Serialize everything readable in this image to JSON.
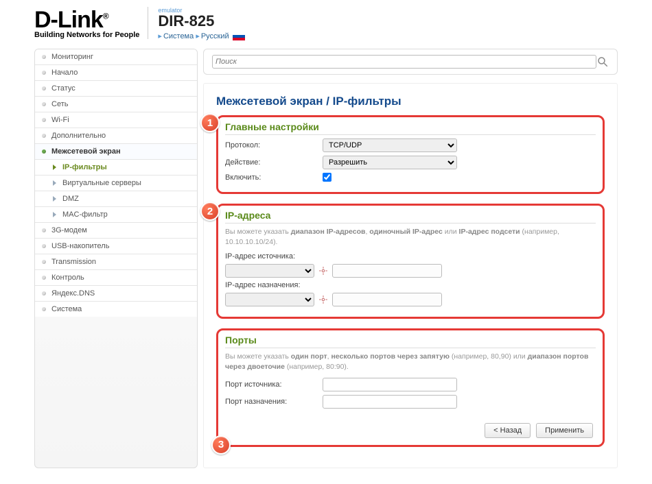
{
  "header": {
    "logo_text": "D-Link",
    "logo_tagline": "Building Networks for People",
    "emulator_label": "emulator",
    "product_name": "DIR-825",
    "breadcrumb_system": "Система",
    "breadcrumb_lang": "Русский"
  },
  "search": {
    "placeholder": "Поиск"
  },
  "sidebar": {
    "items": [
      {
        "label": "Мониторинг"
      },
      {
        "label": "Начало"
      },
      {
        "label": "Статус"
      },
      {
        "label": "Сеть"
      },
      {
        "label": "Wi-Fi"
      },
      {
        "label": "Дополнительно"
      },
      {
        "label": "Межсетевой экран",
        "selected": true
      },
      {
        "label": "3G-модем"
      },
      {
        "label": "USB-накопитель"
      },
      {
        "label": "Transmission"
      },
      {
        "label": "Контроль"
      },
      {
        "label": "Яндекс.DNS"
      },
      {
        "label": "Система"
      }
    ],
    "subitems": [
      {
        "label": "IP-фильтры",
        "active": true
      },
      {
        "label": "Виртуальные серверы"
      },
      {
        "label": "DMZ"
      },
      {
        "label": "MAC-фильтр"
      }
    ]
  },
  "page": {
    "title": "Межсетевой экран /  IP-фильтры"
  },
  "section1": {
    "title": "Главные настройки",
    "protocol_label": "Протокол:",
    "protocol_value": "TCP/UDP",
    "action_label": "Действие:",
    "action_value": "Разрешить",
    "enable_label": "Включить:"
  },
  "section2": {
    "title": "IP-адреса",
    "desc_prefix": "Вы можете указать ",
    "desc_b1": "диапазон IP-адресов",
    "desc_mid1": ", ",
    "desc_b2": "одиночный IP-адрес",
    "desc_mid2": " или ",
    "desc_b3": "IP-адрес подсети",
    "desc_suffix": " (например, 10.10.10.10/24).",
    "src_label": "IP-адрес источника:",
    "dst_label": "IP-адрес назначения:"
  },
  "section3": {
    "title": "Порты",
    "desc_prefix": "Вы можете указать ",
    "desc_b1": "один порт",
    "desc_mid1": ", ",
    "desc_b2": "несколько портов через запятую",
    "desc_mid2": " (например, 80,90) или ",
    "desc_b3": "диапазон портов через двоеточие",
    "desc_suffix": " (например, 80:90).",
    "src_label": "Порт источника:",
    "dst_label": "Порт назначения:"
  },
  "buttons": {
    "back": "< Назад",
    "apply": "Применить"
  },
  "badges": {
    "n1": "1",
    "n2": "2",
    "n3": "3"
  }
}
